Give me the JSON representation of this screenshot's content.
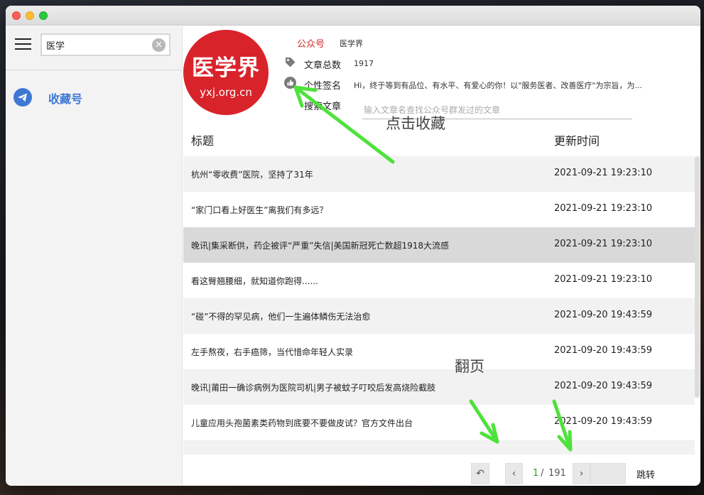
{
  "sidebar": {
    "search": {
      "value": "医学",
      "clear_glyph": "✕"
    },
    "items": [
      {
        "label": "收藏号",
        "icon": "telegram-send-icon"
      }
    ]
  },
  "account": {
    "logo": {
      "cn": "医学界",
      "en": "yxj.org.cn"
    },
    "account_label": "公众号",
    "account_name": "医学界",
    "article_count_label": "文章总数",
    "article_count": "1917",
    "signature_label": "个性签名",
    "signature": "Hi，终于等到有品位、有水平、有爱心的你！以\"服务医者、改善医疗\"为宗旨，为...",
    "search_label": "搜索文章",
    "search_placeholder": "输入文章名查找公众号群发过的文章"
  },
  "table": {
    "headers": {
      "title": "标题",
      "time": "更新时间"
    },
    "rows": [
      {
        "title": "杭州“零收费”医院，坚持了31年",
        "time": "2021-09-21 19:23:10"
      },
      {
        "title": "“家门口看上好医生”离我们有多远？",
        "time": "2021-09-21 19:23:10"
      },
      {
        "title": "晚讯|集采断供，药企被评“严重”失信|美国新冠死亡数超1918大流感",
        "time": "2021-09-21 19:23:10"
      },
      {
        "title": "看这臀翘腰细，就知道你跑得......",
        "time": "2021-09-21 19:23:10"
      },
      {
        "title": "“碰”不得的罕见病，他们一生遍体鳞伤无法治愈",
        "time": "2021-09-20 19:43:59"
      },
      {
        "title": "左手熬夜，右手癌筛，当代惜命年轻人实录",
        "time": "2021-09-20 19:43:59"
      },
      {
        "title": "晚讯|莆田一确诊病例为医院司机|男子被蚊子叮咬后发高烧险截肢",
        "time": "2021-09-20 19:43:59"
      },
      {
        "title": "儿童应用头孢菌素类药物到底要不要做皮试？官方文件出台",
        "time": "2021-09-20 19:43:59"
      },
      {
        "title": "",
        "time": ""
      }
    ]
  },
  "pagination": {
    "back_glyph": "↶",
    "prev_glyph": "‹",
    "next_glyph": "›",
    "current_page": "1",
    "separator": "/",
    "total_pages": "191",
    "jump_label": "跳转"
  },
  "annotations": {
    "favorite_hint": "点击收藏",
    "paging_hint": "翻页",
    "arrow_color": "#4ee23a"
  },
  "colors": {
    "accent_blue": "#3f78d4",
    "account_red": "#d42a2a",
    "logo_red": "#d9232b",
    "current_page_green": "#2aa02a"
  }
}
